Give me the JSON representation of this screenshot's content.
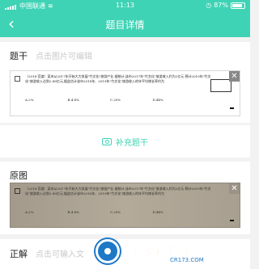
{
  "status_bar": {
    "carrier": "中国联通",
    "time": "11:13",
    "battery": "87%",
    "battery_level": 0.87
  },
  "nav": {
    "back_glyph": "‹",
    "title": "题目详情"
  },
  "stem_section": {
    "label": "题干",
    "hint": "点击图片可编辑"
  },
  "question": {
    "number_box": "",
    "text": "（2018·官渡）某市从2017年开始大力发展\"竹文化\"旅游产业.据统计,该市2017年\"竹文化\"旅游收入约为2亿元.预计2019年\"竹文化\"旅游收入达到2.88亿元,据此估计该市2018年、2019年\"竹文化\"旅游收入的年平均增长率约为",
    "options": [
      "A.2%",
      "B.4.4%",
      "C.20%",
      "D.44%"
    ]
  },
  "supplement_button": "补充题干",
  "original_section": {
    "label": "原图"
  },
  "answer_section": {
    "label": "正解",
    "hint": "点击可输入文"
  },
  "icons": {
    "back": "chevron-left-icon",
    "close": "close-icon",
    "camera": "camera-icon",
    "wifi": "wifi-icon",
    "alarm": "alarm-icon"
  },
  "colors": {
    "accent": "#3fd3b5"
  },
  "watermark": {
    "text": "西西软件园",
    "url": "CR173.COM"
  }
}
